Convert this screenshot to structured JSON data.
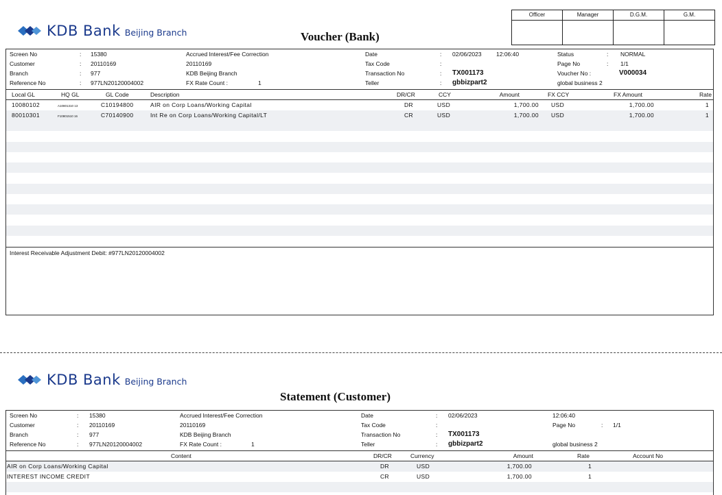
{
  "bank": {
    "name": "KDB Bank",
    "branch": "Beijing Branch",
    "brand_color": "#1b3a8c"
  },
  "voucher": {
    "title": "Voucher (Bank)",
    "approval": [
      "Officer",
      "Manager",
      "D.G.M.",
      "G.M."
    ],
    "header": {
      "screen_no_label": "Screen No",
      "screen_no": "15380",
      "screen_name": "Accrued Interest/Fee Correction",
      "customer_label": "Customer",
      "customer": "20110169",
      "customer_name": "20110169",
      "branch_label": "Branch",
      "branch": "977",
      "branch_name": "KDB Beijing Branch",
      "reference_label": "Reference No",
      "reference": "977LN20120004002",
      "fx_rate_count_label": "FX Rate Count :",
      "fx_rate_count": "1",
      "date_label": "Date",
      "date": "02/06/2023",
      "time": "12:06:40",
      "tax_code_label": "Tax Code",
      "tax_code": "",
      "transaction_label": "Transaction No",
      "transaction": "TX001173",
      "teller_label": "Teller",
      "teller": "gbbizpart2",
      "status_label": "Status",
      "status": "NORMAL",
      "page_label": "Page No",
      "page": "1/1",
      "voucher_label": "Voucher No :",
      "voucher_no": "V000034",
      "business": "global business 2"
    },
    "columns": {
      "local_gl": "Local GL",
      "hq_gl": "HQ GL",
      "gl_code": "GL Code",
      "description": "Description",
      "drcr": "DR/CR",
      "ccy": "CCY",
      "amount": "Amount",
      "fx_ccy": "FX CCY",
      "fx_amount": "FX Amount",
      "rate": "Rate"
    },
    "rows": [
      {
        "local_gl": "10080102",
        "hq_gl": "A10801310 13",
        "gl_code": "C10194800",
        "description": "AIR on Corp Loans/Working Capital",
        "drcr": "DR",
        "ccy": "USD",
        "amount": "1,700.00",
        "fx_ccy": "USD",
        "fx_amount": "1,700.00",
        "rate": "1"
      },
      {
        "local_gl": "80010301",
        "hq_gl": "F10801510 16",
        "gl_code": "C70140900",
        "description": "Int Re on Corp Loans/Working Capital/LT",
        "drcr": "CR",
        "ccy": "USD",
        "amount": "1,700.00",
        "fx_ccy": "USD",
        "fx_amount": "1,700.00",
        "rate": "1"
      }
    ],
    "memo": "Interest Receivable Adjustment Debit: #977LN20120004002"
  },
  "statement": {
    "title": "Statement (Customer)",
    "header": {
      "screen_no_label": "Screen No",
      "screen_no": "15380",
      "screen_name": "Accrued Interest/Fee Correction",
      "customer_label": "Customer",
      "customer": "20110169",
      "customer_name": "20110169",
      "branch_label": "Branch",
      "branch": "977",
      "branch_name": "KDB Beijing Branch",
      "reference_label": "Reference No",
      "reference": "977LN20120004002",
      "fx_rate_count_label": "FX Rate Count :",
      "fx_rate_count": "1",
      "date_label": "Date",
      "date": "02/06/2023",
      "time": "12:06:40",
      "tax_code_label": "Tax Code",
      "tax_code": "",
      "transaction_label": "Transaction No",
      "transaction": "TX001173",
      "teller_label": "Teller",
      "teller": "gbbizpart2",
      "page_label": "Page No",
      "page": "1/1",
      "business": "global business 2"
    },
    "columns": {
      "content": "Content",
      "drcr": "DR/CR",
      "currency": "Currency",
      "amount": "Amount",
      "rate": "Rate",
      "account_no": "Account No"
    },
    "rows": [
      {
        "content": "AIR on Corp Loans/Working Capital",
        "drcr": "DR",
        "currency": "USD",
        "amount": "1,700.00",
        "rate": "1",
        "account_no": ""
      },
      {
        "content": "INTEREST INCOME CREDIT",
        "drcr": "CR",
        "currency": "USD",
        "amount": "1,700.00",
        "rate": "1",
        "account_no": ""
      }
    ]
  }
}
